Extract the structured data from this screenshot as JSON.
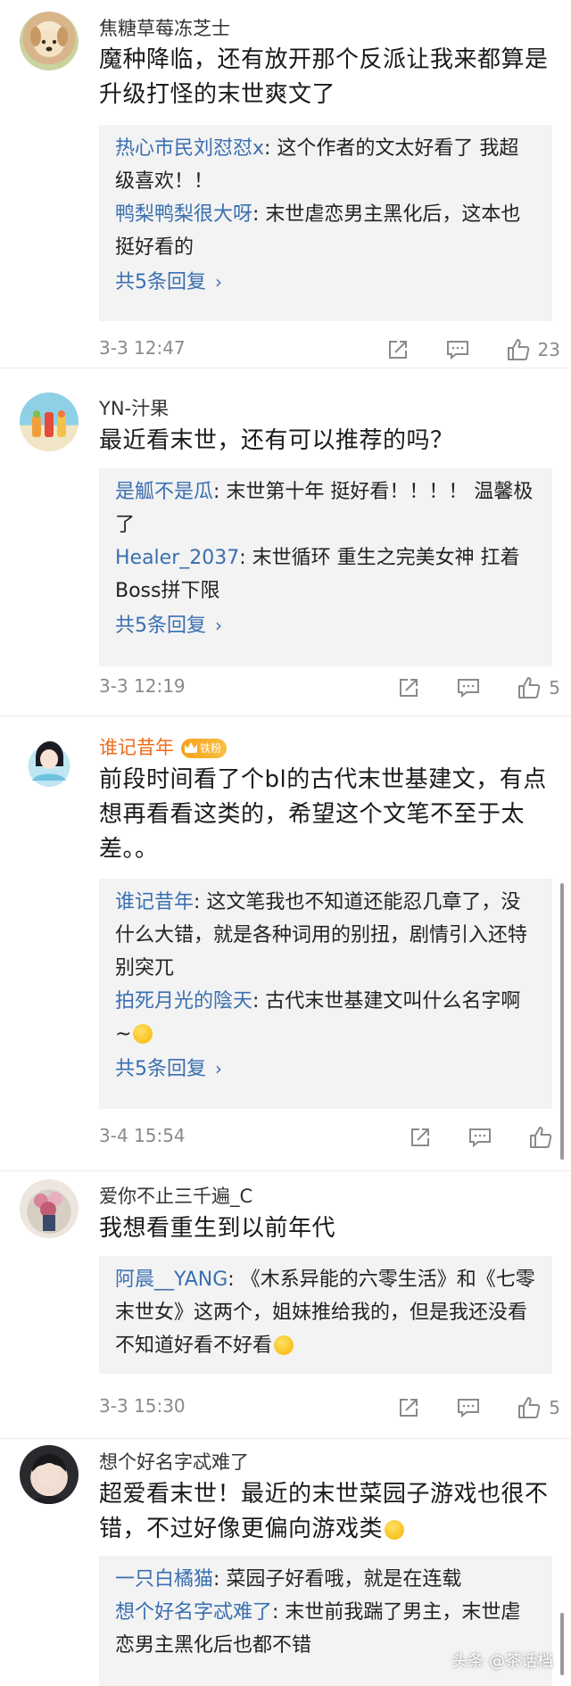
{
  "comments": [
    {
      "author": "焦糖草莓冻芝士",
      "text": "魔种降临，还有放开那个反派让我来都算是升级打怪的末世爽文了",
      "replies": [
        {
          "name": "热心市民刘怼怼x",
          "text": ": 这个作者的文太好看了 我超级喜欢！！"
        },
        {
          "name": "鸭梨鸭梨很大呀",
          "text": ": 末世虐恋男主黑化后，这本也挺好看的"
        }
      ],
      "more_replies": "共5条回复",
      "time": "3-3 12:47",
      "likes": "23"
    },
    {
      "author": "YN-汁果",
      "text": "最近看末世，还有可以推荐的吗？",
      "replies": [
        {
          "name": "是觚不是瓜",
          "text": ": 末世第十年 挺好看！！！！ 温馨极了"
        },
        {
          "name": "Healer_2037",
          "text": ": 末世循环 重生之完美女神 扛着Boss拼下限"
        }
      ],
      "more_replies": "共5条回复",
      "time": "3-3 12:19",
      "likes": "5"
    },
    {
      "author": "谁记昔年",
      "badge": "铁粉",
      "text": "前段时间看了个bl的古代末世基建文，有点想再看看这类的，希望这个文笔不至于太差。。",
      "replies": [
        {
          "name": "谁记昔年",
          "text": ": 这文笔我也不知道还能忍几章了，没什么大错，就是各种词用的别扭，剧情引入还特别突兀"
        },
        {
          "name": "拍死月光的陰天",
          "text": ": 古代末世基建文叫什么名字啊~"
        }
      ],
      "more_replies": "共5条回复",
      "time": "3-4 15:54",
      "likes": ""
    },
    {
      "author": "爱你不止三千遍_C",
      "text": "我想看重生到以前年代",
      "replies": [
        {
          "name": "阿晨__YANG",
          "text": ": 《木系异能的六零生活》和《七零末世女》这两个，姐妹推给我的，但是我还没看不知道好看不好看"
        }
      ],
      "more_replies": "",
      "time": "3-3 15:30",
      "likes": "5"
    },
    {
      "author": "想个好名字忒难了",
      "text": "超爱看末世！最近的末世菜园子游戏也很不错，不过好像更偏向游戏类",
      "replies": [
        {
          "name": "一只白橘猫",
          "text": ": 菜园子好看哦，就是在连载"
        },
        {
          "name": "想个好名字忒难了",
          "text": ": 末世前我踹了男主，末世虐恋男主黑化后也都不错"
        }
      ],
      "more_replies": "",
      "time": "",
      "likes": ""
    }
  ],
  "watermark": "头条 @茶话档",
  "colors": {
    "link": "#3a6fb0",
    "vip_name": "#ef6b1a",
    "reply_bg": "#f3f3f3",
    "meta": "#8a8a8a"
  },
  "icons": [
    "share-icon",
    "comment-icon",
    "like-icon",
    "chevron-right-icon"
  ]
}
